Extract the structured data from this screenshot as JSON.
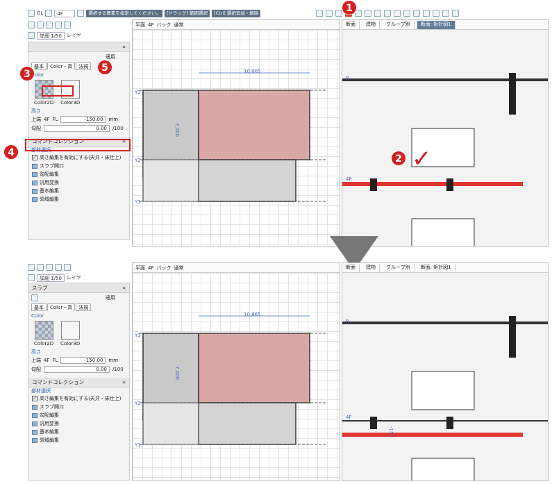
{
  "top": {
    "toolbar1": {
      "gl": "GL",
      "floor": "4F",
      "prompt": "選択する要素を指定してください。",
      "hint1": "[ドラッグ] 範囲選択",
      "hint2": "[Ctrl] 選択追加・解除"
    },
    "toolbar2": {
      "detail": "詳細 1/50",
      "layer": "レイヤ"
    },
    "plan_view": {
      "title": "平面",
      "floor": "4F",
      "back": "バック",
      "mode": "通常"
    },
    "section_tabs": [
      "断面",
      "建物",
      "グループ別",
      "断面: 矩計図1"
    ],
    "panel": {
      "apply": "適用",
      "tabs": [
        "基本",
        "Color・高",
        "法規"
      ],
      "color_label": "Color",
      "c2d": "Color2D",
      "c3d": "Color3D",
      "height_label": "高さ",
      "upper": "上端",
      "upper_floor": "4F",
      "upper_ref": "FL",
      "upper_value": "-150.00",
      "upper_unit": "mm",
      "slope": "勾配",
      "slope_value": "0.00",
      "slope_unit": "/100"
    },
    "commands": {
      "title": "コマンドコレクション",
      "section": "部材選択",
      "check": "高さ編集を有効にする(天井・床仕上)",
      "items": [
        "スラブ開口",
        "勾配編集",
        "汎用変換",
        "基本編集",
        "領域編集"
      ]
    },
    "dim_top": "10,865",
    "dim_side": "7,000",
    "grid": {
      "y3": "Y3",
      "y2": "Y2",
      "y1": "Y1",
      "r": "R",
      "f4": "4F"
    },
    "badges": [
      "1",
      "2",
      "3",
      "4",
      "5"
    ]
  },
  "bottom": {
    "panel_title": "スラブ",
    "apply": "適用",
    "tabs": [
      "基本",
      "Color・高",
      "法規"
    ],
    "color_label": "Color",
    "c2d": "Color2D",
    "c3d": "Color3D",
    "height_label": "高さ",
    "upper": "上端",
    "upper_floor": "4F",
    "upper_ref": "FL",
    "upper_value": "-150.00",
    "upper_unit": "mm",
    "slope": "勾配",
    "slope_value": "0.00",
    "slope_unit": "/100",
    "dim_section": "-150"
  },
  "colors": {
    "badge": "#d42020",
    "slab": "#d9a8a5",
    "slab_section": "#e0362f",
    "panel_bg": "#f4f4f4"
  }
}
